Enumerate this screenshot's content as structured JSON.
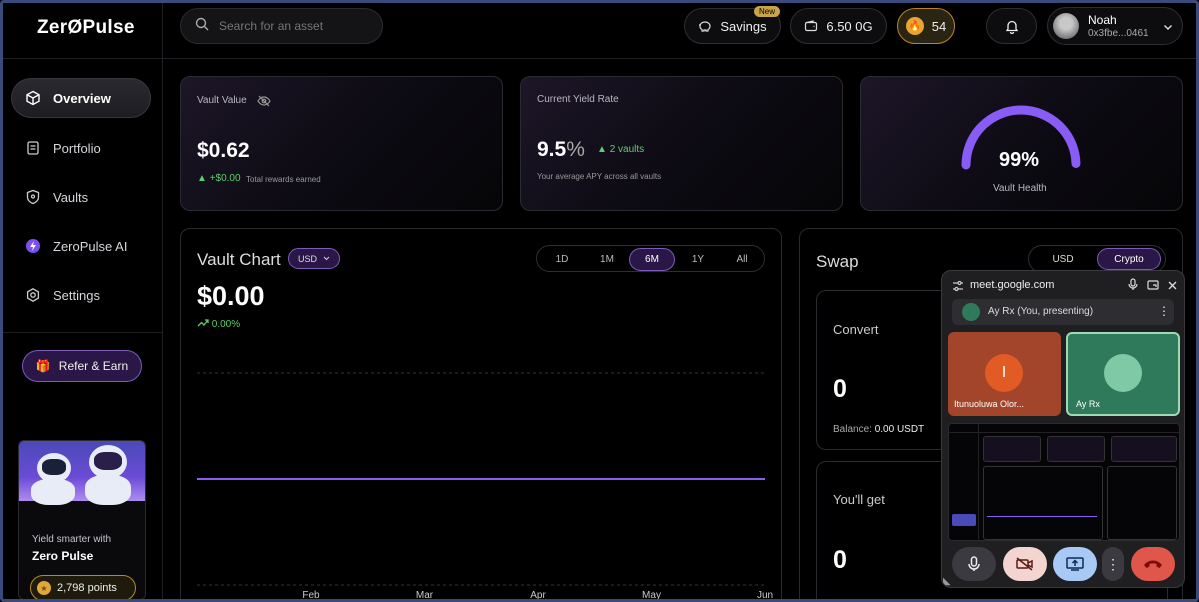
{
  "brand": {
    "logo": "ZerØPulse"
  },
  "sidebar": {
    "items": [
      {
        "label": "Overview"
      },
      {
        "label": "Portfolio"
      },
      {
        "label": "Vaults"
      },
      {
        "label": "ZeroPulse AI"
      },
      {
        "label": "Settings"
      }
    ],
    "refer": "Refer & Earn",
    "promo": {
      "subtitle": "Yield smarter with",
      "title": "Zero Pulse",
      "points": "2,798 points"
    }
  },
  "topbar": {
    "search_placeholder": "Search for an asset",
    "savings": "Savings",
    "savings_badge": "New",
    "balance": "6.50 0G",
    "streak": "54",
    "user_name": "Noah",
    "user_address": "0x3fbe...0461"
  },
  "cards": {
    "vault_value": {
      "label": "Vault Value",
      "value": "$0.62",
      "change": "+$0.00",
      "change_note": "Total rewards earned"
    },
    "yield": {
      "label": "Current Yield Rate",
      "value": "9.5",
      "unit": "%",
      "vaults": "2 vaults",
      "note": "Your average APY across all vaults"
    },
    "health": {
      "value": "99%",
      "label": "Vault Health",
      "fraction": 0.99
    }
  },
  "vault_chart": {
    "title": "Vault Chart",
    "currency": "USD",
    "value": "$0.00",
    "change": "0.00%",
    "ranges": [
      "1D",
      "1M",
      "6M",
      "1Y",
      "All"
    ],
    "active_range": "6M"
  },
  "chart_data": {
    "type": "line",
    "x": [
      "Feb",
      "Mar",
      "Apr",
      "May",
      "Jun"
    ],
    "series": [
      {
        "values": [
          0,
          0,
          0,
          0,
          0
        ]
      }
    ],
    "grid": true
  },
  "swap": {
    "title": "Swap",
    "toggle": [
      "USD",
      "Crypto"
    ],
    "active": "Crypto",
    "convert_label": "Convert",
    "convert_value": "0",
    "balance_label": "Balance:",
    "balance_value": "0.00 USDT",
    "get_label": "You'll get",
    "get_value": "0"
  },
  "meet": {
    "url": "meet.google.com",
    "presenter": "Ay Rx (You, presenting)",
    "tiles": [
      {
        "initial": "I",
        "name": "Itunuoluwa Olor..."
      },
      {
        "name": "Ay Rx"
      }
    ]
  },
  "colors": {
    "accent": "#8a5cf6",
    "positive": "#58d26a",
    "streak": "#e8a530"
  }
}
